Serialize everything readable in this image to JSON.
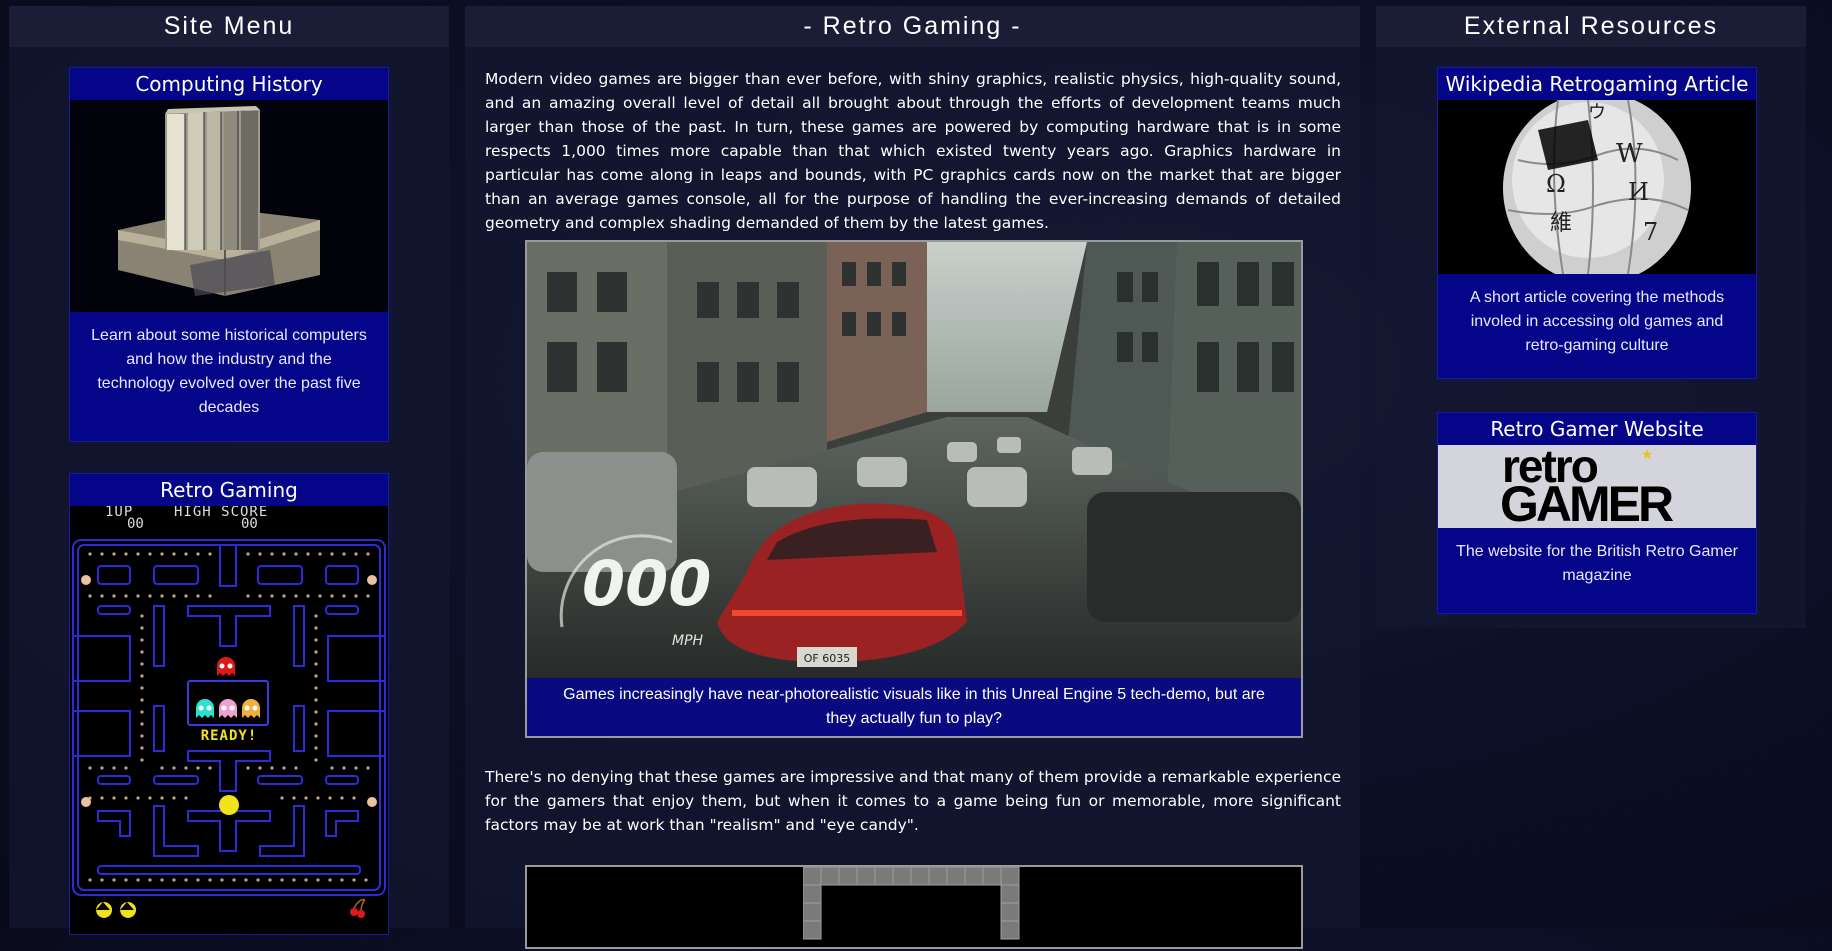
{
  "left_panel": {
    "title": "Site Menu",
    "cards": [
      {
        "title": "Computing History",
        "description": "Learn about some historical computers and how the industry and the technology evolved over the past five decades"
      },
      {
        "title": "Retro Gaming",
        "hud_1up": "1UP",
        "hud_high_score": "HIGH SCORE",
        "hud_score_1": "00",
        "hud_score_2": "00",
        "ready_text": "READY!"
      }
    ]
  },
  "center_panel": {
    "title": "- Retro Gaming -",
    "paragraph_1": "Modern video games are bigger than ever before, with shiny graphics, realistic physics, high-quality sound, and an amazing overall level of detail all brought about through the efforts of development teams much larger than those of the past. In turn, these games are powered by computing hardware that is in some respects 1,000 times more capable than that which existed twenty years ago. Graphics hardware in particular has come along in leaps and bounds, with PC graphics cards now on the market that are bigger than an average games console, all for the purpose of handling the ever-increasing demands of detailed geometry and complex shading demanded of them by the latest games.",
    "figure_1": {
      "speed": "000",
      "speed_unit": "MPH",
      "plate": "OF 6035",
      "caption": "Games increasingly have near-photorealistic visuals like in this Unreal Engine 5 tech-demo, but are they actually fun to play?"
    },
    "paragraph_2": "There's no denying that these games are impressive and that many of them provide a remarkable experience for the gamers that enjoy them, but when it comes to a game being fun or memorable, more significant factors may be at work than \"realism\" and \"eye candy\"."
  },
  "right_panel": {
    "title": "External Resources",
    "cards": [
      {
        "title": "Wikipedia Retrogaming Article",
        "description": "A short article covering the methods involed in accessing old games and retro-gaming culture"
      },
      {
        "title": "Retro Gamer Website",
        "logo_line_1": "retro",
        "logo_line_2": "GAMER",
        "description": "The website for the British Retro Gamer magazine"
      }
    ]
  },
  "colors": {
    "card_blue": "#05058a",
    "panel_header": "#1c1e38",
    "background": "#0d1027"
  }
}
